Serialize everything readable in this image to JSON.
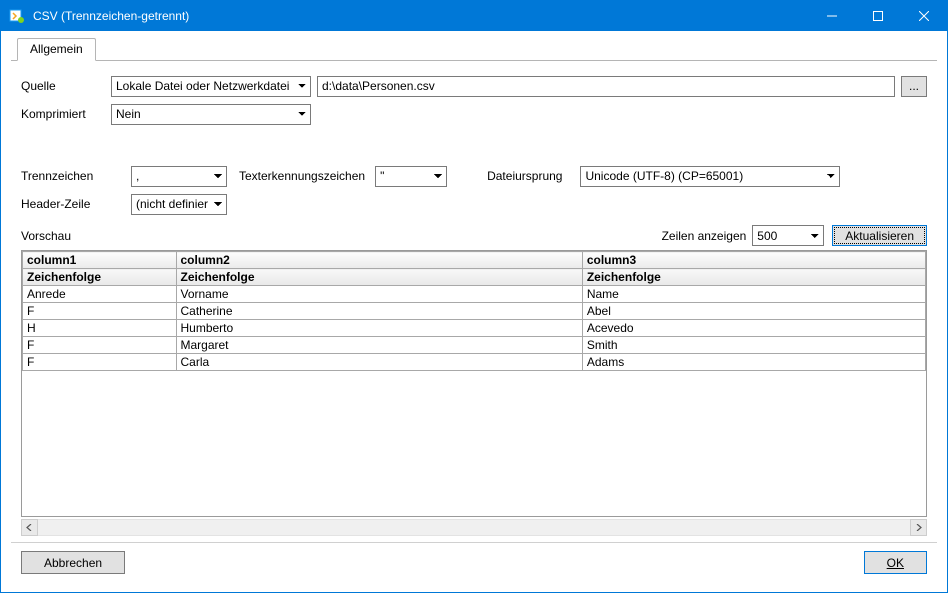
{
  "window": {
    "title": "CSV (Trennzeichen-getrennt)"
  },
  "tabs": {
    "general": "Allgemein"
  },
  "form": {
    "source_label": "Quelle",
    "source_type": "Lokale Datei oder Netzwerkdatei",
    "source_path": "d:\\data\\Personen.csv",
    "browse": "...",
    "compressed_label": "Komprimiert",
    "compressed_value": "Nein"
  },
  "parse": {
    "delimiter_label": "Trennzeichen",
    "delimiter_value": ",",
    "text_qualifier_label": "Texterkennungszeichen",
    "text_qualifier_value": "\"",
    "file_origin_label": "Dateiursprung",
    "file_origin_value": "Unicode (UTF-8) (CP=65001)",
    "header_row_label": "Header-Zeile",
    "header_row_value": "(nicht definiert)"
  },
  "preview": {
    "label": "Vorschau",
    "rows_label": "Zeilen anzeigen",
    "rows_value": "500",
    "refresh": "Aktualisieren",
    "columns": [
      "column1",
      "column2",
      "column3"
    ],
    "types": [
      "Zeichenfolge",
      "Zeichenfolge",
      "Zeichenfolge"
    ],
    "rows": [
      [
        "Anrede",
        "Vorname",
        "Name"
      ],
      [
        "F",
        "Catherine",
        "Abel"
      ],
      [
        "H",
        "Humberto",
        "Acevedo"
      ],
      [
        "F",
        "Margaret",
        "Smith"
      ],
      [
        "F",
        "Carla",
        "Adams"
      ]
    ]
  },
  "footer": {
    "cancel": "Abbrechen",
    "ok": "OK"
  }
}
